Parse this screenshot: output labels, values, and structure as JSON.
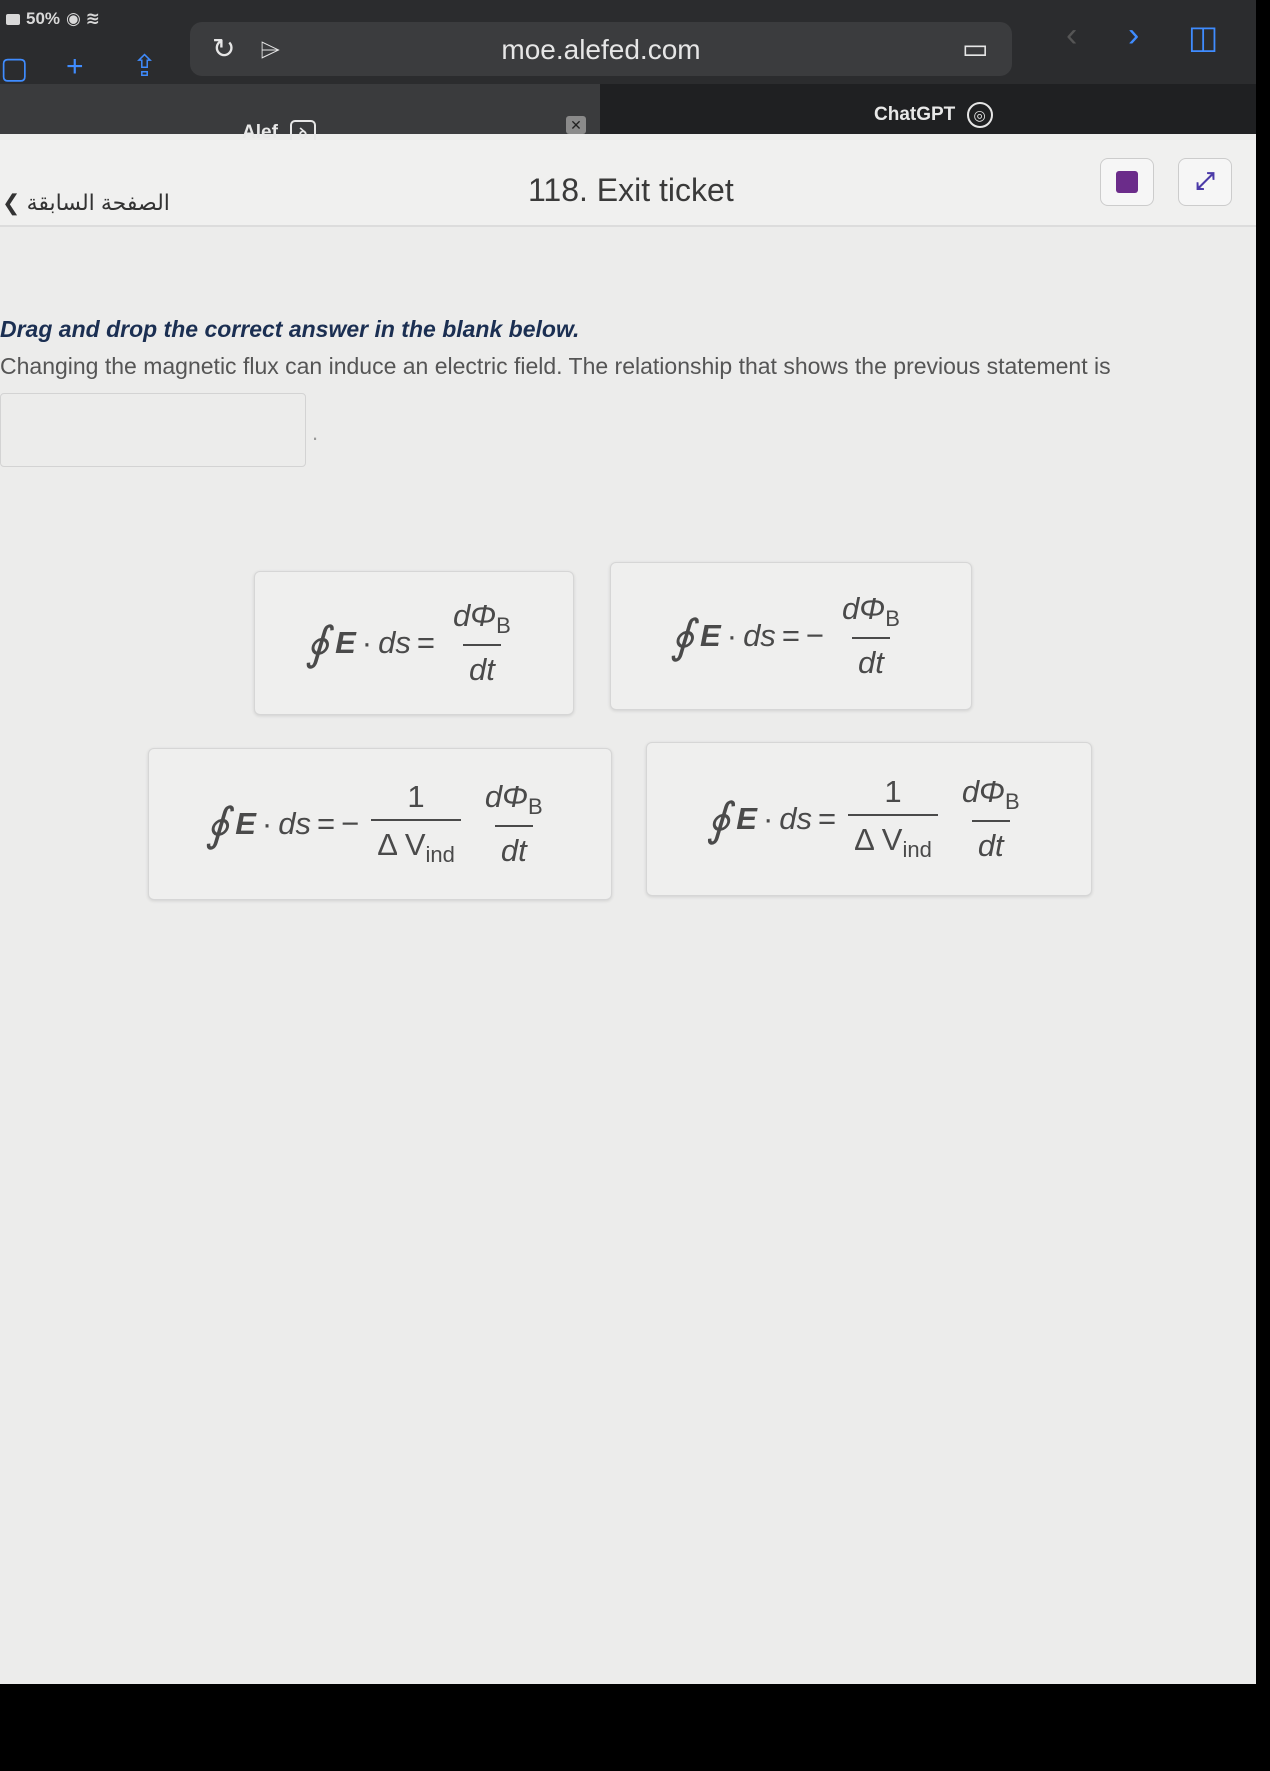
{
  "status": {
    "battery": "50%"
  },
  "browser": {
    "url": "moe.alefed.com",
    "tabs": [
      {
        "label": "Alef",
        "icon": "ꝺ"
      },
      {
        "label": "ChatGPT",
        "icon": "◎"
      }
    ],
    "close_glyph": "✕"
  },
  "header": {
    "back_label": "الصفحة السابقة",
    "title": "118. Exit ticket"
  },
  "question": {
    "instruction": "Drag and drop the correct answer in the blank below.",
    "text": "Changing the magnetic flux can induce an electric field. The relationship that shows the previous statement is",
    "suffix": "."
  },
  "options": {
    "common": {
      "oint": "∮",
      "E": "E",
      "dot": "·",
      "ds": "ds",
      "eq": "=",
      "minus": "−",
      "dPhi": "dΦ",
      "B": "B",
      "dt": "dt",
      "one": "1",
      "dV": "Δ V",
      "ind": "ind"
    }
  },
  "colors": {
    "accent_blue": "#3f8cff",
    "text_dark": "#1b2f52"
  }
}
